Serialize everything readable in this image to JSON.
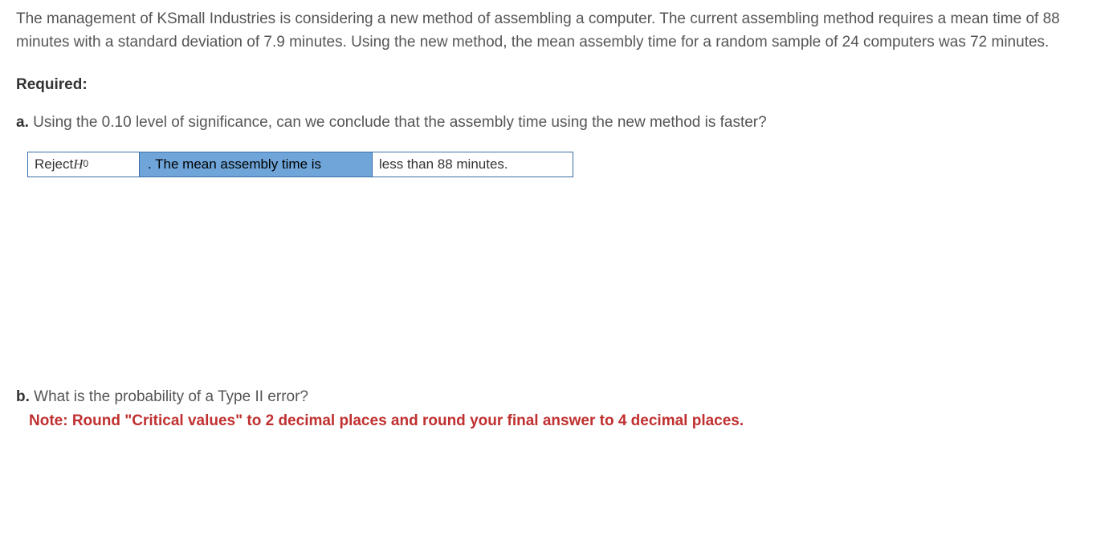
{
  "problem": {
    "intro": "The management of KSmall Industries is considering a new method of assembling a computer. The current assembling method requires a mean time of 88 minutes with a standard deviation of 7.9 minutes. Using the new method, the mean assembly time for a random sample of 24 computers was 72 minutes."
  },
  "required_label": "Required:",
  "part_a": {
    "label": "a.",
    "text": " Using the 0.10 level of significance, can we conclude that the assembly time using the new method is faster?",
    "answer_cell1_prefix": "Reject ",
    "answer_cell1_var": "H",
    "answer_cell1_sub": "0",
    "answer_cell2": ". The mean assembly time is",
    "answer_cell3": "less than 88 minutes."
  },
  "part_b": {
    "label": "b.",
    "text": " What is the probability of a Type II error?",
    "note": "Note: Round \"Critical values\" to 2 decimal places and round your final answer to 4 decimal places."
  }
}
